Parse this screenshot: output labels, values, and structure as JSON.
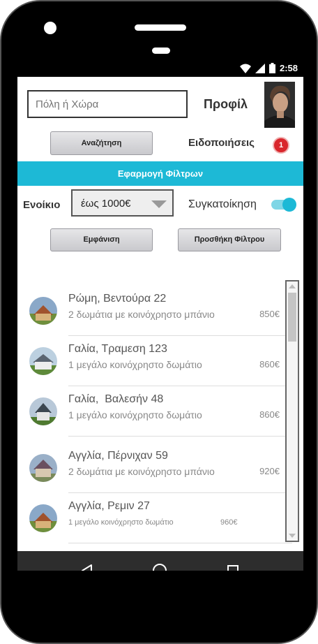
{
  "status_bar": {
    "time": "2:58"
  },
  "header": {
    "search_placeholder": "Πόλη ή Χώρα",
    "profile_label": "Προφίλ",
    "search_button": "Αναζήτηση",
    "notifications_label": "Ειδοποιήσεις",
    "notifications_count": "1"
  },
  "filters": {
    "apply_label": "Εφαρμογή Φίλτρων",
    "rent_label": "Ενοίκιο",
    "rent_value": "έως 1000€",
    "share_label": "Συγκατοίκηση",
    "share_enabled": true,
    "show_button": "Εμφάνιση",
    "add_filter_button": "Προσθήκη Φίλτρου"
  },
  "listings": [
    {
      "title": "Ρώμη, Βεντούρα 22",
      "subtitle": "2 δωμάτια με κοινόχρηστο μπάνιο",
      "price": "850€"
    },
    {
      "title": "Γαλία, Τραμεση 123",
      "subtitle": "1 μεγάλο κοινόχρηστο δωμάτιο",
      "price": "860€"
    },
    {
      "title": "Γαλία,  Βαλεσήν 48",
      "subtitle": "1 μεγάλο κοινόχρηστο δωμάτιο",
      "price": "860€"
    },
    {
      "title": "Αγγλία, Πέρνιχαν 59",
      "subtitle": "2 δωμάτια με κοινόχρηστο μπάνιο",
      "price": "920€"
    },
    {
      "title": "Αγγλία, Ρεμιν 27",
      "subtitle": "1 μεγάλο κοινόχρηστο δωμάτιο",
      "price": "960€"
    }
  ],
  "colors": {
    "accent": "#1db9d6",
    "badge": "#d9262c",
    "navbar": "#2d2d2d"
  },
  "icons": [
    "wifi-icon",
    "signal-icon",
    "battery-icon",
    "back-icon",
    "home-icon",
    "recents-icon"
  ]
}
